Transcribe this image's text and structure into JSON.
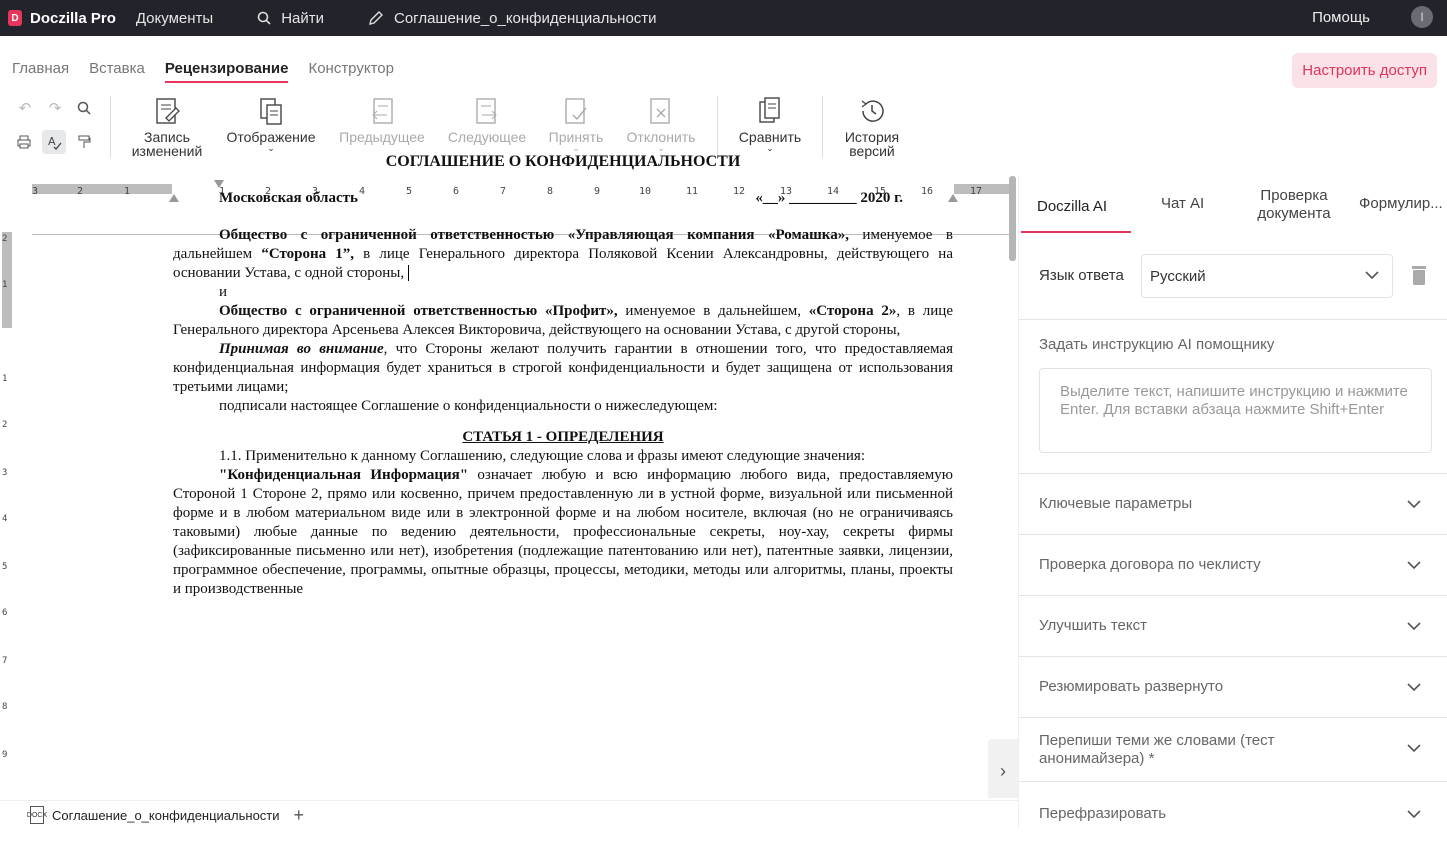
{
  "topbar": {
    "logo_text": "Doczilla Pro",
    "documents": "Документы",
    "search": "Найти",
    "doc_title": "Соглашение_о_конфиденциальности",
    "help": "Помощь",
    "avatar_letter": "I"
  },
  "tabs": [
    "Главная",
    "Вставка",
    "Рецензирование",
    "Конструктор"
  ],
  "access_button": "Настроить доступ",
  "toolbar": {
    "track_changes": [
      "Запись",
      "изменений"
    ],
    "display": "Отображение",
    "previous": "Предыдущее",
    "next": "Следующее",
    "accept": "Принять",
    "reject": "Отклонить",
    "compare": "Сравнить",
    "history": [
      "История",
      "версий"
    ]
  },
  "ruler": {
    "horizontal": [
      "3",
      "2",
      "1",
      "1",
      "2",
      "3",
      "4",
      "5",
      "6",
      "7",
      "8",
      "9",
      "10",
      "11",
      "12",
      "13",
      "14",
      "15",
      "16",
      "17"
    ],
    "vertical": [
      "2",
      "1",
      "1",
      "2",
      "3",
      "4",
      "5",
      "6",
      "7",
      "8",
      "9"
    ]
  },
  "document": {
    "title": "СОГЛАШЕНИЕ О КОНФИДЕНЦИАЛЬНОСТИ",
    "place": "Московская область",
    "date": "«__» _________ 2020 г.",
    "party1_bold": "Общество с ограниченной ответственностью «Управляющая компания «Ромашка»,",
    "party1_text1": " именуемое в дальнейшем ",
    "party1_bold2": "“Сторона 1”,",
    "party1_text2": " в лице Генерального директора Поляковой Ксении Александровны, действующего на основании Устава, с одной стороны,",
    "and": "и",
    "party2_bold": "Общество с ограниченной ответственностью «Профит»,",
    "party2_text1": " именуемое в дальнейшем, ",
    "party2_bold2": "«Сторона 2»",
    "party2_text2": ", в лице Генерального директора Арсеньева Алексея Викторовича, действующего на основании Устава, с другой стороны,",
    "whereas_bold": "Принимая во внимание",
    "whereas_text": ", что Стороны желают получить гарантии в отношении того, что предоставляемая конфиденциальная информация будет храниться в строгой конфиденциальности и будет защищена от использования третьими лицами;",
    "signed": "подписали настоящее Соглашение о конфиденциальности о нижеследующем:",
    "article1": "СТАТЬЯ 1 - ОПРЕДЕЛЕНИЯ",
    "p11": "1.1. Применительно к данному Соглашению, следующие слова и фразы имеют следующие значения:",
    "ci_bold": "\"Конфиденциальная Информация\"",
    "ci_text": " означает любую и всю информацию любого вида, предоставляемую Стороной 1 Стороне 2, прямо или косвенно, причем предоставленную ли в устной форме, визуальной или письменной форме и в любом материальном виде или в электронной форме и на любом носителе, включая (но не ограничиваясь таковыми) любые данные по ведению деятельности, профессиональные секреты, ноу-хау, секреты фирмы (зафиксированные письменно или нет), изобретения (подлежащие патентованию или нет), патентные заявки, лицензии, программное обеспечение, программы, опытные образцы, процессы, методики, методы или алгоритмы, планы, проекты и производственные"
  },
  "bottombar": {
    "doc_icon": "DOCX",
    "doc_name": "Соглашение_о_конфиденциальности",
    "plus": "+"
  },
  "panel": {
    "tabs": [
      "Doczilla AI",
      "Чат AI",
      "Проверка документа",
      "Формулир..."
    ],
    "lang_label": "Язык ответа",
    "lang_value": "Русский",
    "instr_label": "Задать инструкцию AI помощнику",
    "instr_placeholder": "Выделите текст, напишите инструкцию и нажмите Enter. Для вставки абзаца нажмите Shift+Enter",
    "sections": [
      "Ключевые параметры",
      "Проверка договора по чеклисту",
      "Улучшить текст",
      "Резюмировать развернуто",
      "Перепиши теми же словами (тест анонимайзера) *",
      "Перефразировать"
    ]
  },
  "colors": {
    "accent": "#e8355c",
    "topbar_bg": "#23242b",
    "access_bg": "#fbe2e8"
  }
}
